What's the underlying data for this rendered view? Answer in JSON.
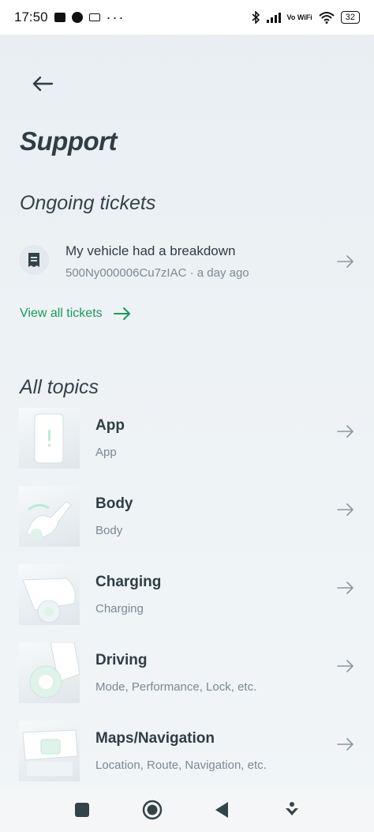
{
  "status_bar": {
    "time": "17:50",
    "more": "···",
    "network": "Vo WiFi",
    "battery": "32"
  },
  "header": {
    "back_icon": "arrow-left-icon",
    "title": "Support"
  },
  "ongoing": {
    "heading": "Ongoing tickets",
    "tickets": [
      {
        "icon": "receipt-icon",
        "title": "My vehicle had a breakdown",
        "meta": "500Ny000006Cu7zIAC · a day ago"
      }
    ],
    "view_all_label": "View all tickets"
  },
  "topics": {
    "heading": "All topics",
    "items": [
      {
        "title": "App",
        "subtitle": "App",
        "thumb": "phone-illustration"
      },
      {
        "title": "Body",
        "subtitle": "Body",
        "thumb": "scooter-body-illustration"
      },
      {
        "title": "Charging",
        "subtitle": "Charging",
        "thumb": "scooter-charging-illustration"
      },
      {
        "title": "Driving",
        "subtitle": "Mode, Performance, Lock, etc.",
        "thumb": "scooter-wheel-illustration"
      },
      {
        "title": "Maps/Navigation",
        "subtitle": "Location, Route, Navigation, etc.",
        "thumb": "scooter-dashboard-illustration"
      }
    ]
  },
  "colors": {
    "accent": "#1a9a5a",
    "title": "#2f3d44",
    "muted": "#7b8a91",
    "background": "#edf2f5"
  },
  "nav_bar": {
    "icons": [
      "square-icon",
      "home-circle-icon",
      "back-triangle-icon",
      "download-gesture-icon"
    ]
  }
}
